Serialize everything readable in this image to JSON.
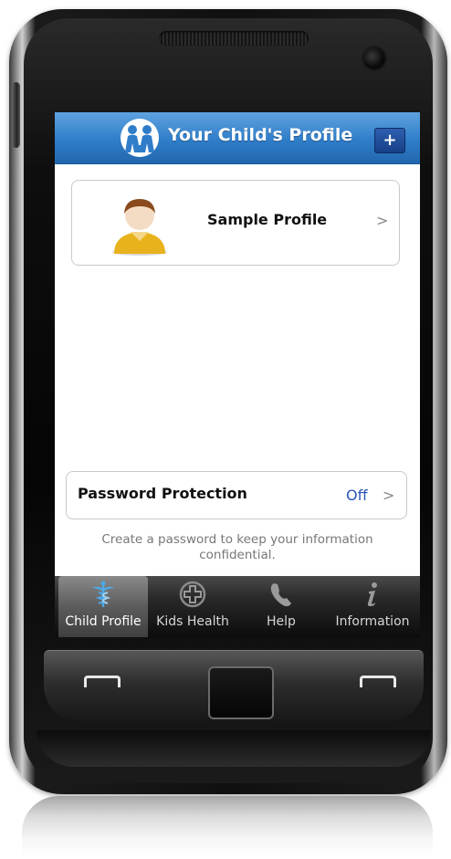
{
  "header": {
    "title": "Your Child's Profile",
    "add_label": "+"
  },
  "profile": {
    "name": "Sample Profile",
    "chevron": ">"
  },
  "password": {
    "label": "Password Protection",
    "value": "Off",
    "chevron": ">",
    "hint": "Create a password to keep your information confidential."
  },
  "tabs": [
    {
      "label": "Child Profile",
      "icon": "caduceus-icon",
      "active": true
    },
    {
      "label": "Kids Health",
      "icon": "health-cross-icon",
      "active": false
    },
    {
      "label": "Help",
      "icon": "phone-icon",
      "active": false
    },
    {
      "label": "Information",
      "icon": "info-icon",
      "active": false
    }
  ],
  "colors": {
    "header_blue": "#2f7dc9",
    "link_blue": "#2a56b8",
    "tabbar_dark": "#0c0c0c",
    "active_tab": "#5c5c5c"
  }
}
